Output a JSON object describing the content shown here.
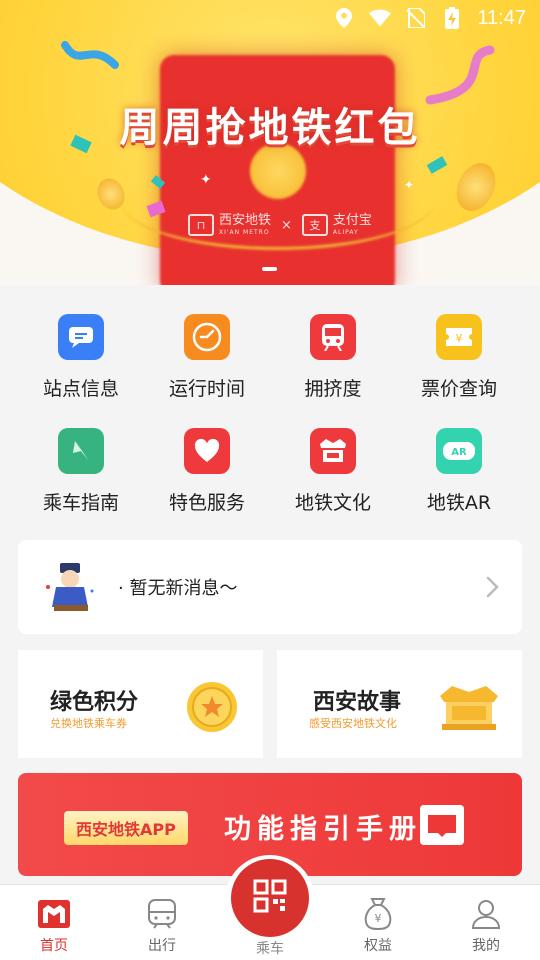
{
  "status_bar": {
    "time": "11:47",
    "icons": [
      "location-icon",
      "wifi-icon",
      "no-sim-icon",
      "battery-charging-icon"
    ]
  },
  "banner": {
    "title": "周周抢地铁红包",
    "logo_left": "西安地铁",
    "logo_left_sub": "XI'AN METRO",
    "separator": "×",
    "logo_right": "支付宝",
    "logo_right_sub": "ALIPAY"
  },
  "grid": [
    {
      "label": "站点信息",
      "icon": "station-info-icon",
      "color": "#3b7ff6"
    },
    {
      "label": "运行时间",
      "icon": "clock-icon",
      "color": "#f88b1f"
    },
    {
      "label": "拥挤度",
      "icon": "train-icon",
      "color": "#ef3a3d"
    },
    {
      "label": "票价查询",
      "icon": "ticket-icon",
      "color": "#f7c21d"
    },
    {
      "label": "乘车指南",
      "icon": "compass-icon",
      "color": "#36b37e"
    },
    {
      "label": "特色服务",
      "icon": "heart-icon",
      "color": "#ef3a3d"
    },
    {
      "label": "地铁文化",
      "icon": "culture-icon",
      "color": "#ef3a3d"
    },
    {
      "label": "地铁AR",
      "icon": "ar-glasses-icon",
      "color": "#33d3b0"
    }
  ],
  "message": {
    "text": "· 暂无新消息～"
  },
  "cards": [
    {
      "title": "绿色积分",
      "subtitle": "兑换地铁乘车券"
    },
    {
      "title": "西安故事",
      "subtitle": "感受西安地铁文化"
    }
  ],
  "guide": {
    "pill": "西安地铁APP",
    "title": "功能指引手册"
  },
  "nav": {
    "items": [
      {
        "label": "首页",
        "icon": "home-icon",
        "active": true
      },
      {
        "label": "出行",
        "icon": "metro-icon",
        "active": false
      },
      {
        "label": "乘车",
        "icon": "qr-code-icon",
        "active": false
      },
      {
        "label": "权益",
        "icon": "money-bag-icon",
        "active": false
      },
      {
        "label": "我的",
        "icon": "user-icon",
        "active": false
      }
    ]
  },
  "colors": {
    "accent": "#e0312e",
    "banner_yellow": "#ffd43a"
  }
}
